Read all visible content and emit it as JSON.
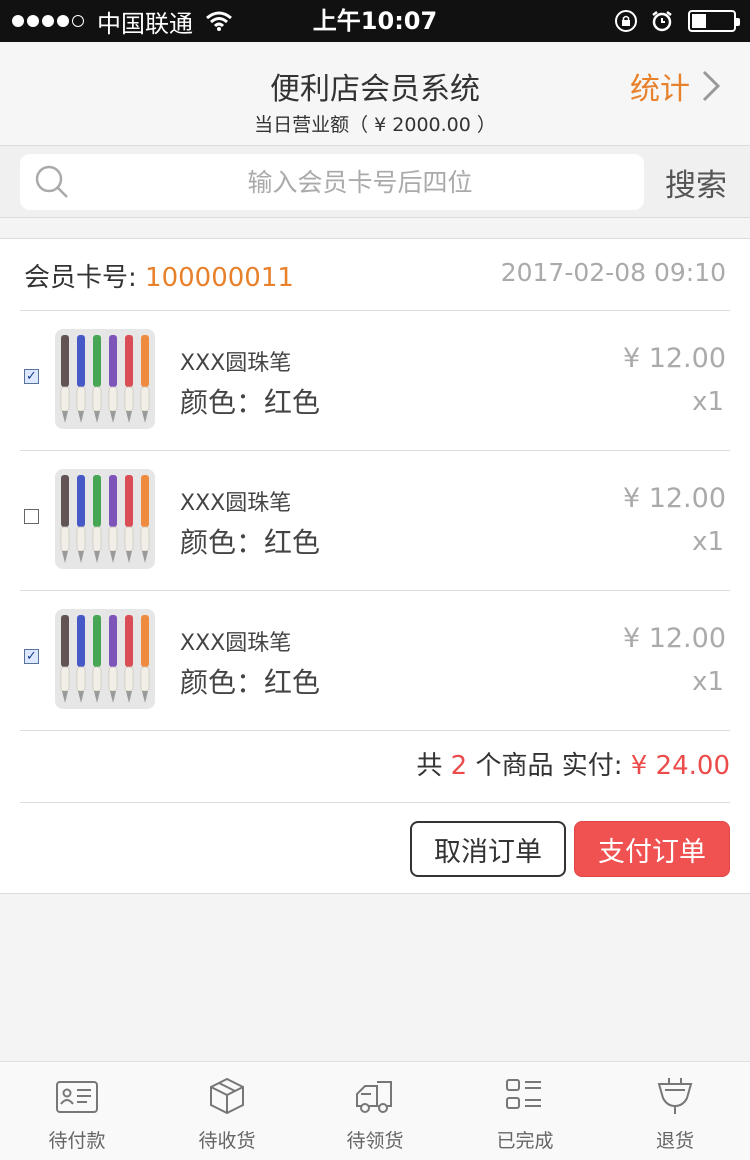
{
  "status_bar": {
    "carrier": "中国联通",
    "time": "上午10:07"
  },
  "header": {
    "title": "便利店会员系统",
    "subtitle": "当日营业额（ ¥ 2000.00 ）",
    "stats_label": "统计"
  },
  "search": {
    "placeholder": "输入会员卡号后四位",
    "button_label": "搜索"
  },
  "order": {
    "member_label": "会员卡号: ",
    "member_no": "100000011",
    "time": "2017-02-08 09:10",
    "items": [
      {
        "name": "XXX圆珠笔",
        "spec": "颜色：红色",
        "price": "¥ 12.00",
        "qty": "x1",
        "checked": true
      },
      {
        "name": "XXX圆珠笔",
        "spec": "颜色：红色",
        "price": "¥ 12.00",
        "qty": "x1",
        "checked": false
      },
      {
        "name": "XXX圆珠笔",
        "spec": "颜色：红色",
        "price": "¥ 12.00",
        "qty": "x1",
        "checked": true
      }
    ],
    "summary": {
      "prefix": "共 ",
      "count": "2",
      "middle": " 个商品  实付: ",
      "total": "¥ 24.00"
    },
    "cancel_label": "取消订单",
    "pay_label": "支付订单"
  },
  "tabs": [
    {
      "label": "待付款",
      "icon": "card-icon"
    },
    {
      "label": "待收货",
      "icon": "box-icon"
    },
    {
      "label": "待领货",
      "icon": "truck-icon"
    },
    {
      "label": "已完成",
      "icon": "list-icon"
    },
    {
      "label": "退货",
      "icon": "return-icon"
    }
  ],
  "colors": {
    "accent_orange": "#e8812b",
    "accent_red": "#ec4b4b",
    "pay_button": "#f05252"
  }
}
